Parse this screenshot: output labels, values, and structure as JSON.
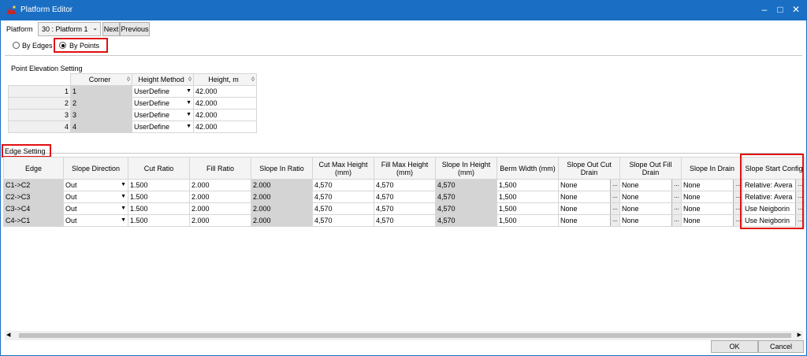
{
  "window": {
    "title": "Platform Editor",
    "minimize": "‒",
    "maximize": "□",
    "close": "✕"
  },
  "toolbar": {
    "platform_label": "Platform",
    "platform_value": "30 : Platform 1",
    "next": "Next",
    "previous": "Previous"
  },
  "mode": {
    "by_edges": "By Edges",
    "by_points": "By Points",
    "selected": "By Points"
  },
  "points": {
    "section_title": "Point Elevation Setting",
    "headers": [
      "Corner",
      "Height Method",
      "Height, m"
    ],
    "rows": [
      {
        "index": "1",
        "corner": "1",
        "method": "UserDefine",
        "height": "42.000"
      },
      {
        "index": "2",
        "corner": "2",
        "method": "UserDefine",
        "height": "42.000"
      },
      {
        "index": "3",
        "corner": "3",
        "method": "UserDefine",
        "height": "42.000"
      },
      {
        "index": "4",
        "corner": "4",
        "method": "UserDefine",
        "height": "42.000"
      }
    ]
  },
  "edges": {
    "section_title": "Edge Setting",
    "headers": [
      "Edge",
      "Slope Direction",
      "Cut Ratio",
      "Fill Ratio",
      "Slope In Ratio",
      "Cut Max Height (mm)",
      "Fill Max Height (mm)",
      "Slope In Height (mm)",
      "Berm Width (mm)",
      "Slope Out Cut Drain",
      "Slope Out Fill Drain",
      "Slope In Drain",
      "Slope Start Config"
    ],
    "rows": [
      {
        "edge": "C1->C2",
        "direction": "Out",
        "cut": "1.500",
        "fill": "2.000",
        "slope_in": "2.000",
        "cut_max": "4,570",
        "fill_max": "4,570",
        "slope_in_h": "4,570",
        "berm": "1,500",
        "out_cut_drain": "None",
        "out_fill_drain": "None",
        "in_drain": "None",
        "start_config": "Relative: Avera"
      },
      {
        "edge": "C2->C3",
        "direction": "Out",
        "cut": "1.500",
        "fill": "2.000",
        "slope_in": "2.000",
        "cut_max": "4,570",
        "fill_max": "4,570",
        "slope_in_h": "4,570",
        "berm": "1,500",
        "out_cut_drain": "None",
        "out_fill_drain": "None",
        "in_drain": "None",
        "start_config": "Relative: Avera"
      },
      {
        "edge": "C3->C4",
        "direction": "Out",
        "cut": "1.500",
        "fill": "2.000",
        "slope_in": "2.000",
        "cut_max": "4,570",
        "fill_max": "4,570",
        "slope_in_h": "4,570",
        "berm": "1,500",
        "out_cut_drain": "None",
        "out_fill_drain": "None",
        "in_drain": "None",
        "start_config": "Use Neigborin"
      },
      {
        "edge": "C4->C1",
        "direction": "Out",
        "cut": "1.500",
        "fill": "2.000",
        "slope_in": "2.000",
        "cut_max": "4,570",
        "fill_max": "4,570",
        "slope_in_h": "4,570",
        "berm": "1,500",
        "out_cut_drain": "None",
        "out_fill_drain": "None",
        "in_drain": "None",
        "start_config": "Use Neigborin"
      }
    ]
  },
  "ellipsis": "...",
  "dialog": {
    "ok": "OK",
    "cancel": "Cancel"
  },
  "colors": {
    "titlebar": "#1a6fc4",
    "highlight": "#e01010",
    "readonly_cell": "#d4d4d4"
  }
}
